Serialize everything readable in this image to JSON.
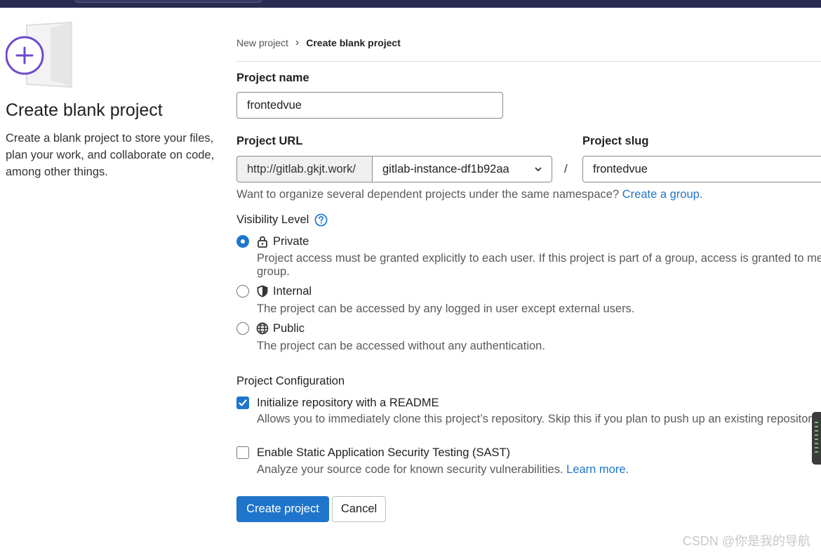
{
  "breadcrumb": {
    "parent": "New project",
    "separator": "›",
    "current": "Create blank project"
  },
  "intro": {
    "title": "Create blank project",
    "description": "Create a blank project to store your files, plan your work, and collaborate on code, among other things."
  },
  "project_name": {
    "label": "Project name",
    "value": "frontedvue"
  },
  "project_url": {
    "label": "Project URL",
    "prefix": "http://gitlab.gkjt.work/",
    "namespace": "gitlab-instance-df1b92aa",
    "separator": "/"
  },
  "project_slug": {
    "label": "Project slug",
    "value": "frontedvue"
  },
  "namespace_help": {
    "text": "Want to organize several dependent projects under the same namespace? ",
    "link": "Create a group."
  },
  "visibility": {
    "label": "Visibility Level",
    "help_icon": "question-circle-icon",
    "options": [
      {
        "label": "Private",
        "icon": "lock-icon",
        "checked": true,
        "desc_line1": "Project access must be granted explicitly to each user. If this project is part of a group, access is granted to me",
        "desc_line2": "group."
      },
      {
        "label": "Internal",
        "icon": "shield-icon",
        "checked": false,
        "desc_line1": "The project can be accessed by any logged in user except external users."
      },
      {
        "label": "Public",
        "icon": "globe-icon",
        "checked": false,
        "desc_line1": "The project can be accessed without any authentication."
      }
    ]
  },
  "config": {
    "label": "Project Configuration",
    "readme": {
      "label": "Initialize repository with a README",
      "checked": true,
      "desc": "Allows you to immediately clone this project’s repository. Skip this if you plan to push up an existing repositor"
    },
    "sast": {
      "label": "Enable Static Application Security Testing (SAST)",
      "checked": false,
      "desc": "Analyze your source code for known security vulnerabilities. ",
      "link": "Learn more."
    }
  },
  "buttons": {
    "create": "Create project",
    "cancel": "Cancel"
  },
  "watermark": "CSDN @你是我的导航",
  "colors": {
    "primary": "#1f75cb",
    "topbar": "#2b2b52",
    "illustration_accent": "#6e49cb"
  }
}
